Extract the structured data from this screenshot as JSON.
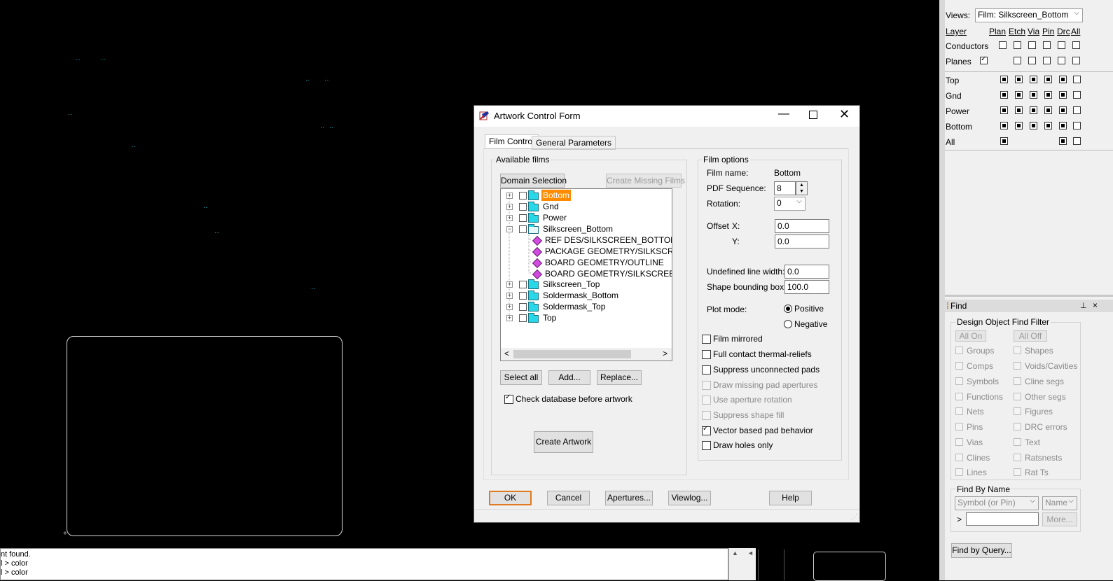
{
  "canvas": {
    "dot_marks": [
      "‥",
      "‥",
      "‥",
      "‥",
      "‥",
      "‥",
      "‥",
      "‥",
      "‥",
      "‥",
      "‥"
    ],
    "cross_mark": "+"
  },
  "command_window": {
    "lines": [
      "nt found.",
      "l > color",
      "l > color"
    ],
    "scroll_up": "▲",
    "scroll_left": "◄"
  },
  "views_panel": {
    "views_label": "Views:",
    "views_value": "Film: Silkscreen_Bottom",
    "header": {
      "layer": "Layer",
      "plan": "Plan",
      "etch": "Etch",
      "via": "Via",
      "pin": "Pin",
      "drc": "Drc",
      "all": "All"
    },
    "rows_top": [
      {
        "label": "Conductors",
        "states": [
          "",
          "empty",
          "empty",
          "empty",
          "empty",
          "empty",
          "empty"
        ]
      },
      {
        "label": "Planes",
        "states": [
          "checked",
          "",
          "empty",
          "empty",
          "empty",
          "empty",
          "empty"
        ]
      }
    ],
    "rows_layers": [
      {
        "label": "Top",
        "states": [
          "filled",
          "filled",
          "filled",
          "filled",
          "filled",
          "empty"
        ]
      },
      {
        "label": "Gnd",
        "states": [
          "filled",
          "filled",
          "filled",
          "filled",
          "filled",
          "empty"
        ]
      },
      {
        "label": "Power",
        "states": [
          "filled",
          "filled",
          "filled",
          "filled",
          "filled",
          "empty"
        ]
      },
      {
        "label": "Bottom",
        "states": [
          "filled",
          "filled",
          "filled",
          "filled",
          "filled",
          "empty"
        ]
      },
      {
        "label": "All",
        "states": [
          "filled",
          "",
          "",
          "",
          "filled",
          "empty"
        ]
      }
    ]
  },
  "find_panel": {
    "title": "Find",
    "pin_icon": "⊥",
    "close_icon": "×",
    "filter_title": "Design Object Find Filter",
    "all_on": "All On",
    "all_off": "All Off",
    "left_items": [
      "Groups",
      "Comps",
      "Symbols",
      "Functions",
      "Nets",
      "Pins",
      "Vias",
      "Clines",
      "Lines"
    ],
    "right_items": [
      "Shapes",
      "Voids/Cavities",
      "Cline segs",
      "Other segs",
      "Figures",
      "DRC errors",
      "Text",
      "Ratsnests",
      "Rat Ts"
    ],
    "find_by_name": "Find By Name",
    "type_select": "Symbol (or Pin)",
    "name_select": "Name",
    "arrow": ">",
    "more": "More...",
    "find_by_query": "Find by Query..."
  },
  "dialog": {
    "title": "Artwork Control Form",
    "tabs": [
      "Film Control",
      "General Parameters"
    ],
    "available_films": "Available films",
    "domain_selection": "Domain Selection",
    "create_missing": "Create Missing Films",
    "tree": [
      {
        "label": "Bottom",
        "kind": "folder",
        "expander": "+",
        "selected": true
      },
      {
        "label": "Gnd",
        "kind": "folder",
        "expander": "+"
      },
      {
        "label": "Power",
        "kind": "folder",
        "expander": "+"
      },
      {
        "label": "Silkscreen_Bottom",
        "kind": "open",
        "expander": "−"
      },
      {
        "label": "REF DES/SILKSCREEN_BOTTOM",
        "kind": "item"
      },
      {
        "label": "PACKAGE GEOMETRY/SILKSCREEN",
        "kind": "item"
      },
      {
        "label": "BOARD GEOMETRY/OUTLINE",
        "kind": "item"
      },
      {
        "label": "BOARD GEOMETRY/SILKSCREEN_E",
        "kind": "item"
      },
      {
        "label": "Silkscreen_Top",
        "kind": "folder",
        "expander": "+"
      },
      {
        "label": "Soldermask_Bottom",
        "kind": "folder",
        "expander": "+"
      },
      {
        "label": "Soldermask_Top",
        "kind": "folder",
        "expander": "+"
      },
      {
        "label": "Top",
        "kind": "folder",
        "expander": "+"
      }
    ],
    "scroll_left": "<",
    "scroll_right": ">",
    "select_all": "Select all",
    "add": "Add...",
    "replace": "Replace...",
    "check_db": "Check database before artwork",
    "create_artwork": "Create Artwork",
    "film_options": "Film options",
    "film_name_label": "Film name:",
    "film_name_value": "Bottom",
    "pdf_seq_label": "PDF Sequence:",
    "pdf_seq_value": "8",
    "rotation_label": "Rotation:",
    "rotation_value": "0",
    "offset_label": "Offset",
    "x_label": "X:",
    "x_value": "0.0",
    "y_label": "Y:",
    "y_value": "0.0",
    "undef_label": "Undefined line width:",
    "undef_value": "0.0",
    "shape_label": "Shape bounding box:",
    "shape_value": "100.0",
    "plot_mode": "Plot mode:",
    "positive": "Positive",
    "negative": "Negative",
    "options": [
      {
        "label": "Film mirrored",
        "checked": false,
        "enabled": true
      },
      {
        "label": "Full contact thermal-reliefs",
        "checked": false,
        "enabled": true
      },
      {
        "label": "Suppress unconnected pads",
        "checked": false,
        "enabled": true
      },
      {
        "label": "Draw missing pad apertures",
        "checked": false,
        "enabled": false
      },
      {
        "label": "Use aperture rotation",
        "checked": false,
        "enabled": false
      },
      {
        "label": "Suppress shape fill",
        "checked": false,
        "enabled": false
      },
      {
        "label": "Vector based pad behavior",
        "checked": true,
        "enabled": true
      },
      {
        "label": "Draw holes only",
        "checked": false,
        "enabled": true
      }
    ],
    "footer": {
      "ok": "OK",
      "cancel": "Cancel",
      "apertures": "Apertures...",
      "viewlog": "Viewlog...",
      "help": "Help"
    },
    "accent": "#e07b1f",
    "select_color": "#ff8c00",
    "arrow_color": "#1f2f8c"
  }
}
